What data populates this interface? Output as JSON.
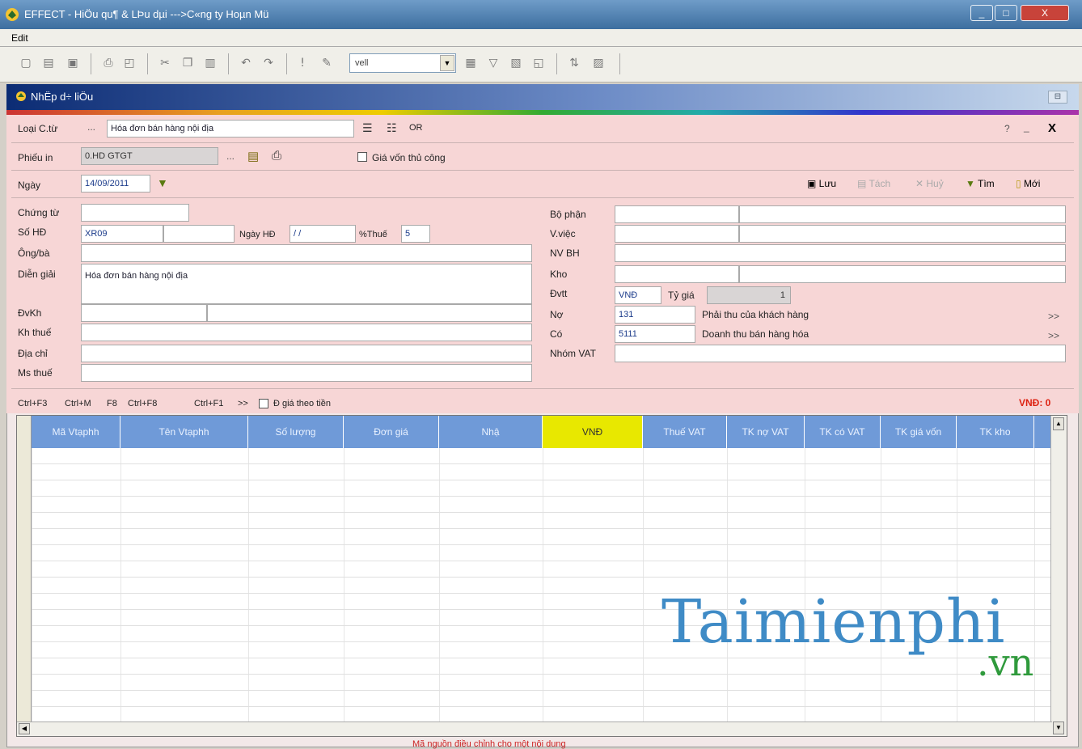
{
  "window": {
    "title": "EFFECT - HiÖu qu¶ & LÞu dµi --->C«ng ty Hoµn Mü",
    "min": "_",
    "max": "□",
    "close": "X"
  },
  "menu": {
    "items": [
      "Edit"
    ]
  },
  "toolbar": {
    "combo_value": "vell"
  },
  "child": {
    "title": "NhËp d÷ liÖu",
    "restore": "⊟"
  },
  "form": {
    "loai_ct_label": "Loại C.từ",
    "loai_ct_value": "Hóa đơn bán hàng nội địa",
    "or_label": "OR",
    "top_right": {
      "help": "?",
      "minimize": "_",
      "close": "X"
    },
    "phieu_in_label": "Phiếu in",
    "phieu_in_value": "0.HD GTGT",
    "gia_von_label": "Giá vốn thủ công",
    "ngay_label": "Ngày",
    "ngay_value": "14/09/2011",
    "actions": {
      "luu": "Lưu",
      "tach": "Tách",
      "huy": "Huỷ",
      "tim": "Tìm",
      "moi": "Mới"
    },
    "left": {
      "chung_tu_label": "Chứng từ",
      "so_hd_label": "Số HĐ",
      "so_hd_value": "XR09",
      "ngay_hd_label": "Ngày HĐ",
      "ngay_hd_value": "/ /",
      "thue_label": "%Thuế",
      "thue_value": "5",
      "ong_ba_label": "Ông/bà",
      "dien_giai_label": "Diễn giải",
      "dien_giai_value": "Hóa đơn bán hàng nội địa",
      "dvkh_label": "ĐvKh",
      "kh_thue_label": "Kh thuế",
      "dia_chi_label": "Địa chỉ",
      "ms_thue_label": "Ms thuế"
    },
    "right": {
      "bo_phan_label": "Bộ phận",
      "v_viec_label": "V.việc",
      "nv_bh_label": "NV BH",
      "kho_label": "Kho",
      "dvtt_label": "Đvtt",
      "dvtt_value": "VNĐ",
      "ty_gia_label": "Tỷ giá",
      "ty_gia_value": "1",
      "no_label": "Nợ",
      "no_value": "131",
      "no_desc": "Phải thu của khách hàng",
      "co_label": "Có",
      "co_value": "5111",
      "co_desc": "Doanh thu bán hàng hóa",
      "nhom_vat_label": "Nhóm VAT",
      "more": ">>"
    }
  },
  "shortcuts": {
    "ctrl_f3": "Ctrl+F3",
    "ctrl_m": "Ctrl+M",
    "f8": "F8",
    "ctrl_f8": "Ctrl+F8",
    "ctrl_f1": "Ctrl+F1",
    "more": ">>",
    "dgia_label": "Đ giá theo tiền",
    "total": "VNĐ: 0"
  },
  "grid": {
    "columns": [
      "Mã Vtạphh",
      "Tên Vtạphh",
      "Số lượng",
      "Đơn giá",
      "Nhậ",
      "VNĐ",
      "Thuế VAT",
      "TK nợ VAT",
      "TK có VAT",
      "TK giá vốn",
      "TK kho"
    ],
    "highlight_color": "#e8e800"
  },
  "watermark": {
    "brand": "Taimienphi",
    "tld": ".vn"
  },
  "footer": {
    "note": "Mã nguồn điều chỉnh cho một nội dung"
  }
}
